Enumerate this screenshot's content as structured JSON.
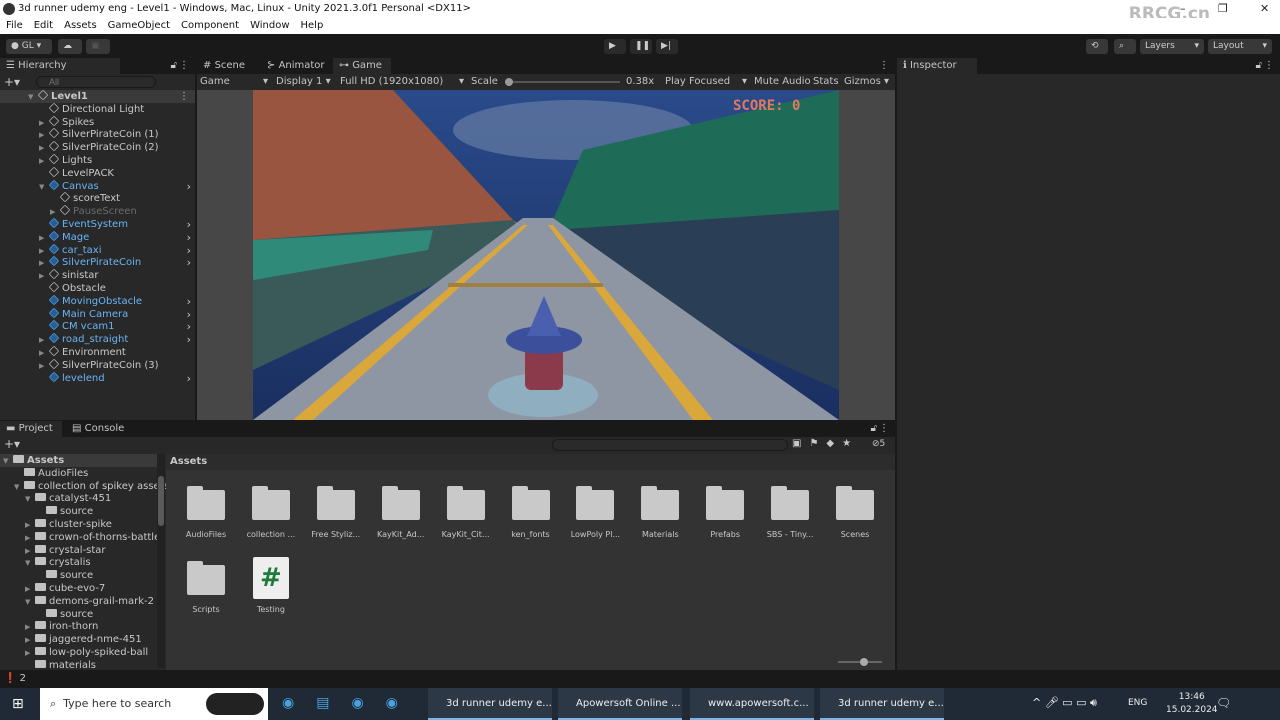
{
  "window": {
    "title": "3d runner udemy eng - Level1 - Windows, Mac, Linux - Unity 2021.3.0f1 Personal <DX11>",
    "watermark": "RRCG.cn"
  },
  "menu": [
    "File",
    "Edit",
    "Assets",
    "GameObject",
    "Component",
    "Window",
    "Help"
  ],
  "toolbar": {
    "account": "GL",
    "layers": "Layers",
    "layout": "Layout"
  },
  "hierarchy": {
    "tab": "Hierarchy",
    "search_placeholder": "All",
    "items": [
      {
        "label": "Level1",
        "depth": 0,
        "type": "scene",
        "expanded": true
      },
      {
        "label": "Directional Light",
        "depth": 1,
        "type": "obj"
      },
      {
        "label": "Spikes",
        "depth": 1,
        "type": "obj",
        "arrow": true
      },
      {
        "label": "SilverPirateCoin (1)",
        "depth": 1,
        "type": "obj",
        "arrow": true
      },
      {
        "label": "SilverPirateCoin (2)",
        "depth": 1,
        "type": "obj",
        "arrow": true
      },
      {
        "label": "Lights",
        "depth": 1,
        "type": "obj",
        "arrow": true
      },
      {
        "label": "LevelPACK",
        "depth": 1,
        "type": "obj"
      },
      {
        "label": "Canvas",
        "depth": 1,
        "type": "prefab",
        "expanded": true,
        "more": true
      },
      {
        "label": "scoreText",
        "depth": 2,
        "type": "obj"
      },
      {
        "label": "PauseScreen",
        "depth": 2,
        "type": "disabled",
        "arrow": true
      },
      {
        "label": "EventSystem",
        "depth": 1,
        "type": "prefab",
        "more": true
      },
      {
        "label": "Mage",
        "depth": 1,
        "type": "prefab",
        "arrow": true,
        "more": true
      },
      {
        "label": "car_taxi",
        "depth": 1,
        "type": "prefab",
        "arrow": true,
        "more": true
      },
      {
        "label": "SilverPirateCoin",
        "depth": 1,
        "type": "prefab",
        "arrow": true,
        "more": true
      },
      {
        "label": "sinistar",
        "depth": 1,
        "type": "obj",
        "arrow": true
      },
      {
        "label": "Obstacle",
        "depth": 1,
        "type": "obj"
      },
      {
        "label": "MovingObstacle",
        "depth": 1,
        "type": "prefab",
        "more": true
      },
      {
        "label": "Main Camera",
        "depth": 1,
        "type": "prefab",
        "more": true
      },
      {
        "label": "CM vcam1",
        "depth": 1,
        "type": "prefab",
        "more": true
      },
      {
        "label": "road_straight",
        "depth": 1,
        "type": "prefab",
        "arrow": true,
        "more": true
      },
      {
        "label": "Environment",
        "depth": 1,
        "type": "obj",
        "arrow": true
      },
      {
        "label": "SilverPirateCoin (3)",
        "depth": 1,
        "type": "obj",
        "arrow": true
      },
      {
        "label": "levelend",
        "depth": 1,
        "type": "prefab",
        "more": true
      }
    ]
  },
  "scene_tabs": [
    "Scene",
    "Animator",
    "Game"
  ],
  "game_bar": {
    "view": "Game",
    "display": "Display 1",
    "resolution": "Full HD (1920x1080)",
    "scale_label": "Scale",
    "scale_value": "0.38x",
    "play_mode": "Play Focused",
    "mute": "Mute Audio",
    "stats": "Stats",
    "gizmos": "Gizmos"
  },
  "game": {
    "score": "SCORE: 0"
  },
  "inspector": {
    "tab": "Inspector"
  },
  "project": {
    "tabs": [
      "Project",
      "Console"
    ],
    "badge": "5",
    "breadcrumb": "Assets",
    "tree": [
      {
        "label": "Assets",
        "depth": 0,
        "open": true
      },
      {
        "label": "AudioFiles",
        "depth": 1
      },
      {
        "label": "collection of spikey assets",
        "depth": 1,
        "open": true
      },
      {
        "label": "catalyst-451",
        "depth": 2,
        "open": true
      },
      {
        "label": "source",
        "depth": 3
      },
      {
        "label": "cluster-spike",
        "depth": 2,
        "arrow": true
      },
      {
        "label": "crown-of-thorns-battle",
        "depth": 2,
        "arrow": true
      },
      {
        "label": "crystal-star",
        "depth": 2,
        "arrow": true
      },
      {
        "label": "crystalis",
        "depth": 2,
        "open": true
      },
      {
        "label": "source",
        "depth": 3
      },
      {
        "label": "cube-evo-7",
        "depth": 2,
        "arrow": true
      },
      {
        "label": "demons-grail-mark-2",
        "depth": 2,
        "open": true
      },
      {
        "label": "source",
        "depth": 3
      },
      {
        "label": "iron-thorn",
        "depth": 2,
        "arrow": true
      },
      {
        "label": "jaggered-nme-451",
        "depth": 2,
        "arrow": true
      },
      {
        "label": "low-poly-spiked-ball",
        "depth": 2,
        "arrow": true
      },
      {
        "label": "materials",
        "depth": 2
      }
    ],
    "assets": [
      {
        "label": "AudioFiles",
        "kind": "folder"
      },
      {
        "label": "collection ...",
        "kind": "folder"
      },
      {
        "label": "Free Styliz...",
        "kind": "folder"
      },
      {
        "label": "KayKit_Ad...",
        "kind": "folder"
      },
      {
        "label": "KayKit_Cit...",
        "kind": "folder"
      },
      {
        "label": "ken_fonts",
        "kind": "folder"
      },
      {
        "label": "LowPoly Pl...",
        "kind": "folder"
      },
      {
        "label": "Materials",
        "kind": "folder"
      },
      {
        "label": "Prefabs",
        "kind": "folder"
      },
      {
        "label": "SBS - Tiny...",
        "kind": "folder"
      },
      {
        "label": "Scenes",
        "kind": "folder"
      },
      {
        "label": "Scripts",
        "kind": "folder"
      },
      {
        "label": "Testing",
        "kind": "script"
      }
    ]
  },
  "status": {
    "warnings": "2"
  },
  "taskbar": {
    "search": "Type here to search",
    "apps": [
      "3d runner udemy e...",
      "Apowersoft Online ...",
      "www.apowersoft.c...",
      "3d runner udemy e..."
    ],
    "lang": "ENG",
    "time": "13:46",
    "date": "15.02.2024"
  }
}
